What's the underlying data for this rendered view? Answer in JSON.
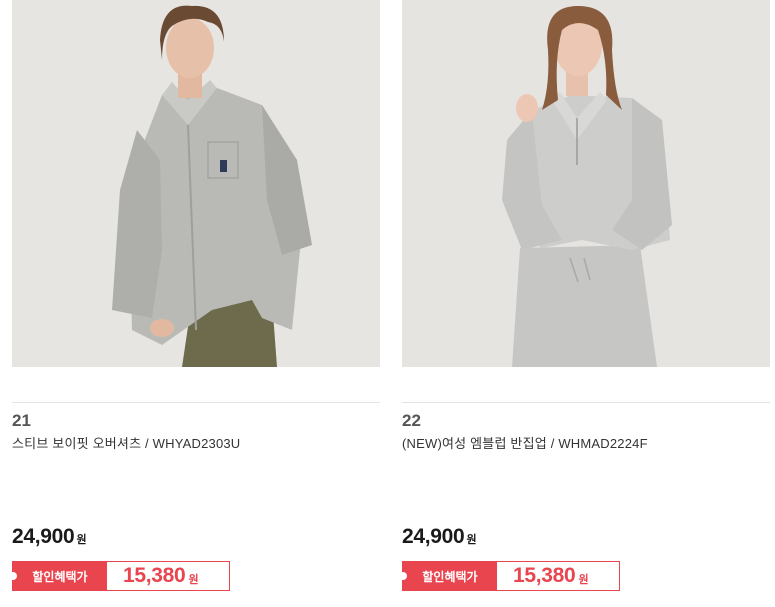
{
  "products": [
    {
      "rank": "21",
      "name": "스티브 보이핏 오버셔츠 / WHYAD2303U",
      "price": "24,900",
      "price_unit": "원",
      "discount_label": "할인혜택가",
      "discount_price": "15,380",
      "discount_unit": "원"
    },
    {
      "rank": "22",
      "name": "(NEW)여성 엠블럽 반집업 / WHMAD2224F",
      "price": "24,900",
      "price_unit": "원",
      "discount_label": "할인혜택가",
      "discount_price": "15,380",
      "discount_unit": "원"
    }
  ],
  "colors": {
    "accent": "#e8454f",
    "text": "#1a1a1a",
    "photo_bg": "#e6e4e1"
  }
}
